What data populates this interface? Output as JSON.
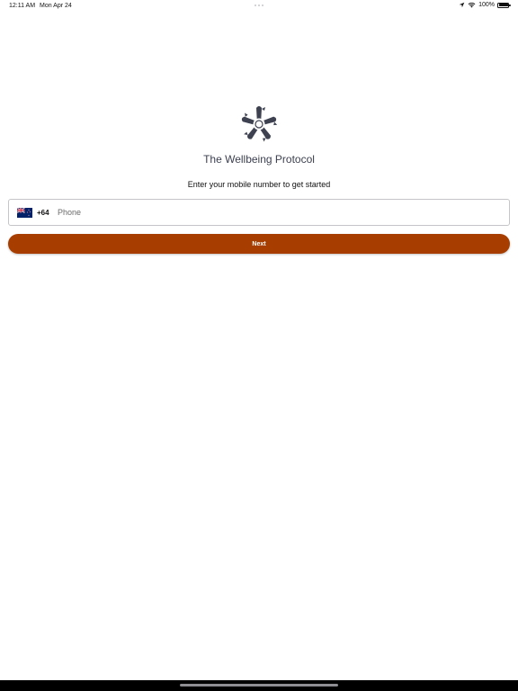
{
  "status_bar": {
    "time": "12:11 AM",
    "date": "Mon Apr 24",
    "battery": "100%"
  },
  "app": {
    "title": "The Wellbeing Protocol",
    "prompt": "Enter your mobile number to get started"
  },
  "phone": {
    "country_flag": "new-zealand-flag-icon",
    "dial_code": "+64",
    "placeholder": "Phone",
    "value": ""
  },
  "next_button": {
    "label": "Next",
    "color": "#a83d00"
  },
  "colors": {
    "title": "#3d4150",
    "logo": "#3d4150"
  }
}
